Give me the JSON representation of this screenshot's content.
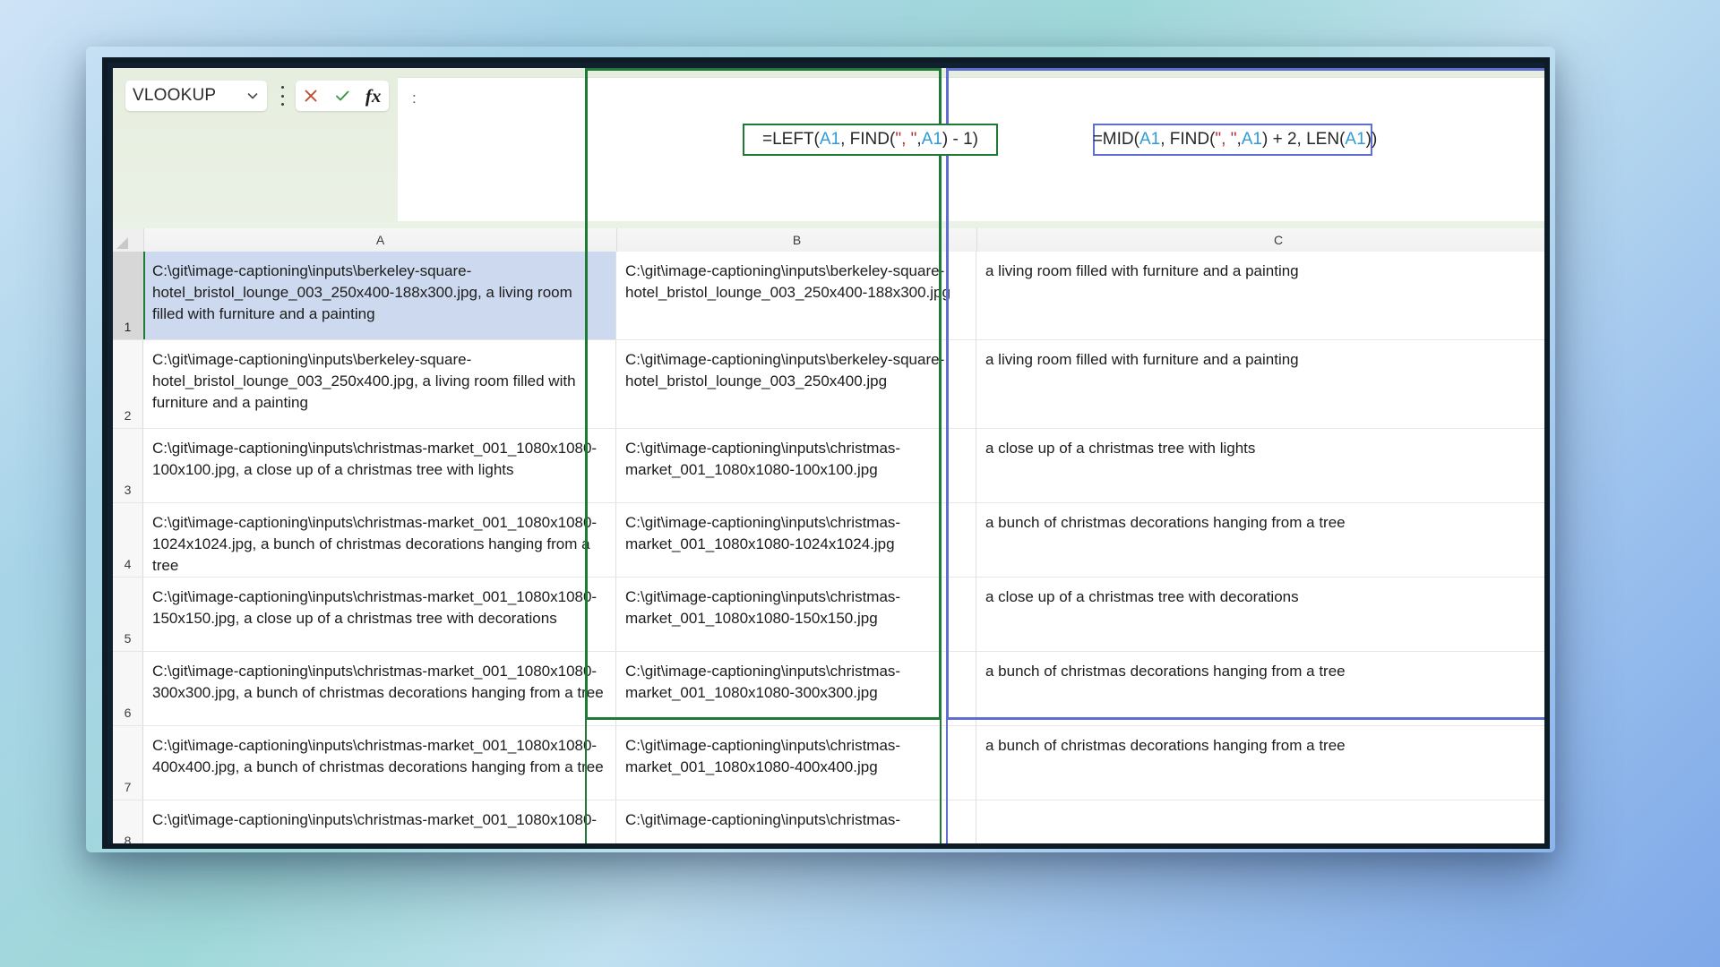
{
  "toolbar": {
    "name_box_value": "VLOOKUP",
    "dropdown_icon": "chevron-down-icon",
    "kebab_icon": "more-options-icon",
    "cancel_icon": "cancel-x-icon",
    "confirm_icon": "confirm-check-icon",
    "function_icon": "fx-insert-function-icon",
    "fx_label": "fx",
    "formula_area_marker": ":"
  },
  "formulas": {
    "column_b": {
      "label": "=LEFT(A1, FIND(\", \", A1) - 1)",
      "tokens": [
        {
          "t": "=LEFT(",
          "k": "plain"
        },
        {
          "t": "A1",
          "k": "ref"
        },
        {
          "t": ", FIND(",
          "k": "plain"
        },
        {
          "t": "\", \"",
          "k": "str"
        },
        {
          "t": ", ",
          "k": "plain"
        },
        {
          "t": "A1",
          "k": "ref"
        },
        {
          "t": ") - 1)",
          "k": "plain"
        }
      ]
    },
    "column_c": {
      "label": "=MID(A1, FIND(\", \", A1) + 2, LEN(A1))",
      "tokens": [
        {
          "t": "=MID(",
          "k": "plain"
        },
        {
          "t": "A1",
          "k": "ref"
        },
        {
          "t": ", FIND(",
          "k": "plain"
        },
        {
          "t": "\", \"",
          "k": "str"
        },
        {
          "t": ", ",
          "k": "plain"
        },
        {
          "t": "A1",
          "k": "ref"
        },
        {
          "t": ") + 2, LEN(",
          "k": "plain"
        },
        {
          "t": "A1",
          "k": "ref"
        },
        {
          "t": "))",
          "k": "plain"
        }
      ],
      "has_caret": true
    }
  },
  "colors": {
    "column_b_accent": "#1e7a34",
    "column_c_accent": "#5f6fd0",
    "selection_fill": "#ccd9ee",
    "cell_reference": "#2e9bd6",
    "string_literal": "#b03030",
    "window_frame": "#10202e"
  },
  "grid": {
    "column_headers": [
      "A",
      "B",
      "C"
    ],
    "row_numbers": [
      "1",
      "2",
      "3",
      "4",
      "5",
      "6",
      "7",
      "8"
    ],
    "rows": [
      {
        "num": "1",
        "selected": true,
        "a": "C:\\git\\image-captioning\\inputs\\berkeley-square-hotel_bristol_lounge_003_250x400-188x300.jpg, a living room filled with furniture and a painting",
        "b": "C:\\git\\image-captioning\\inputs\\berkeley-square-hotel_bristol_lounge_003_250x400-188x300.jpg",
        "c": "a living room filled with furniture and a painting"
      },
      {
        "num": "2",
        "selected": false,
        "a": "C:\\git\\image-captioning\\inputs\\berkeley-square-hotel_bristol_lounge_003_250x400.jpg, a living room filled with furniture and a painting",
        "b": "C:\\git\\image-captioning\\inputs\\berkeley-square-hotel_bristol_lounge_003_250x400.jpg",
        "c": "a living room filled with furniture and a painting"
      },
      {
        "num": "3",
        "selected": false,
        "a": "C:\\git\\image-captioning\\inputs\\christmas-market_001_1080x1080-100x100.jpg, a close up of a christmas tree with lights",
        "b": "C:\\git\\image-captioning\\inputs\\christmas-market_001_1080x1080-100x100.jpg",
        "c": "a close up of a christmas tree with lights"
      },
      {
        "num": "4",
        "selected": false,
        "a": "C:\\git\\image-captioning\\inputs\\christmas-market_001_1080x1080-1024x1024.jpg, a bunch of christmas decorations hanging from a tree",
        "b": "C:\\git\\image-captioning\\inputs\\christmas-market_001_1080x1080-1024x1024.jpg",
        "c": "a bunch of christmas decorations hanging from a tree"
      },
      {
        "num": "5",
        "selected": false,
        "a": "C:\\git\\image-captioning\\inputs\\christmas-market_001_1080x1080-150x150.jpg, a close up of a christmas tree with decorations",
        "b": "C:\\git\\image-captioning\\inputs\\christmas-market_001_1080x1080-150x150.jpg",
        "c": "a close up of a christmas tree with decorations"
      },
      {
        "num": "6",
        "selected": false,
        "a": "C:\\git\\image-captioning\\inputs\\christmas-market_001_1080x1080-300x300.jpg, a bunch of christmas decorations hanging from a tree",
        "b": "C:\\git\\image-captioning\\inputs\\christmas-market_001_1080x1080-300x300.jpg",
        "c": "a bunch of christmas decorations hanging from a tree"
      },
      {
        "num": "7",
        "selected": false,
        "a": "C:\\git\\image-captioning\\inputs\\christmas-market_001_1080x1080-400x400.jpg, a bunch of christmas decorations hanging from a tree",
        "b": "C:\\git\\image-captioning\\inputs\\christmas-market_001_1080x1080-400x400.jpg",
        "c": "a bunch of christmas decorations hanging from a tree"
      },
      {
        "num": "8",
        "selected": false,
        "a": "C:\\git\\image-captioning\\inputs\\christmas-market_001_1080x1080-",
        "b": "C:\\git\\image-captioning\\inputs\\christmas-",
        "c": ""
      }
    ]
  }
}
